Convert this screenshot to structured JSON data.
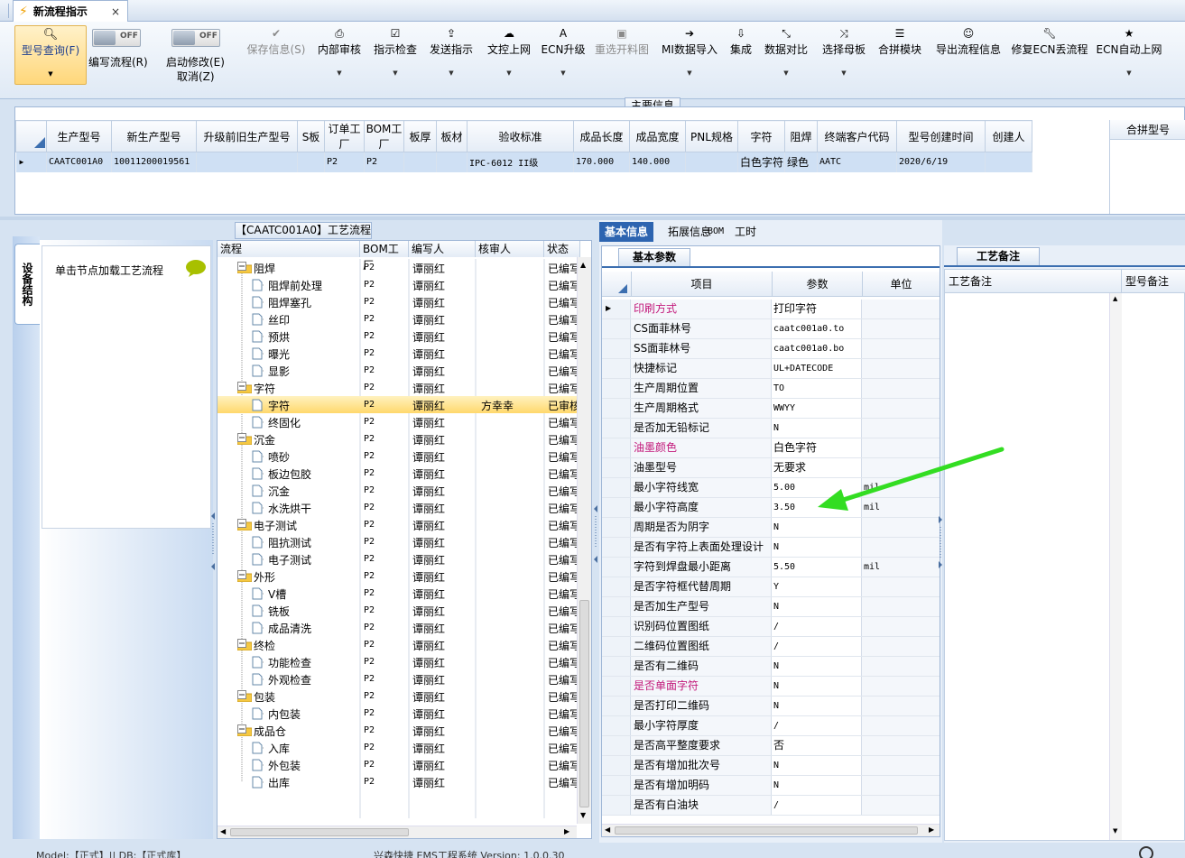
{
  "tab": {
    "title": "新流程指示",
    "close": "×"
  },
  "ribbon": {
    "query": "型号查询(F)",
    "edit_flow": "编写流程(R)",
    "start_modify": "启动修改(E)",
    "cancel": "取消(Z)",
    "toggle_off": "OFF",
    "buttons": [
      {
        "label": "保存信息(S)",
        "icon": "check-icon",
        "disabled": true
      },
      {
        "label": "内部审核",
        "icon": "printer-icon"
      },
      {
        "label": "指示检查",
        "icon": "checkbox-icon"
      },
      {
        "label": "发送指示",
        "icon": "upload-icon"
      },
      {
        "label": "文控上网",
        "icon": "cloud-upload-icon"
      },
      {
        "label": "ECN升级",
        "icon": "font-icon"
      },
      {
        "label": "重选开料图",
        "icon": "image-icon",
        "disabled": true
      },
      {
        "label": "MI数据导入",
        "icon": "sign-in-icon"
      },
      {
        "label": "集成",
        "icon": "download-icon"
      },
      {
        "label": "数据对比",
        "icon": "compress-icon"
      },
      {
        "label": "选择母板",
        "icon": "random-icon"
      },
      {
        "label": "合拼模块",
        "icon": "list-icon"
      },
      {
        "label": "导出流程信息",
        "icon": "smile-icon"
      },
      {
        "label": "修复ECN丢流程",
        "icon": "wrench-icon"
      },
      {
        "label": "ECN自动上网",
        "icon": "star-icon"
      }
    ]
  },
  "main_info": {
    "title": "主要信息",
    "columns": [
      "生产型号",
      "新生产型号",
      "升级前旧生产型号",
      "S板",
      "订单工厂",
      "BOM工厂",
      "板厚",
      "板材",
      "验收标准",
      "成品长度",
      "成品宽度",
      "PNL规格",
      "字符",
      "阻焊",
      "终端客户代码",
      "型号创建时间",
      "创建人"
    ],
    "row": [
      "CAATC001A0",
      "10011200019561",
      "",
      "",
      "P2",
      "P2",
      "",
      "",
      "IPC-6012 II级",
      "170.000",
      "140.000",
      "",
      "白色字符",
      "绿色",
      "AATC",
      "2020/6/19",
      ""
    ],
    "side_title": "合拼型号"
  },
  "process": {
    "title": "【CAATC001A0】工艺流程",
    "side_tab": "设备结构",
    "hint": "单击节点加载工艺流程",
    "columns": [
      "流程",
      "BOM工厂",
      "编写人",
      "核审人",
      "状态"
    ],
    "rows": [
      {
        "name": "阻焊",
        "level": 0,
        "bom": "P2",
        "writer": "谭丽红",
        "reviewer": "",
        "status": "已编写"
      },
      {
        "name": "阻焊前处理",
        "level": 1,
        "bom": "P2",
        "writer": "谭丽红",
        "reviewer": "",
        "status": "已编写"
      },
      {
        "name": "阻焊塞孔",
        "level": 1,
        "bom": "P2",
        "writer": "谭丽红",
        "reviewer": "",
        "status": "已编写"
      },
      {
        "name": "丝印",
        "level": 1,
        "bom": "P2",
        "writer": "谭丽红",
        "reviewer": "",
        "status": "已编写"
      },
      {
        "name": "预烘",
        "level": 1,
        "bom": "P2",
        "writer": "谭丽红",
        "reviewer": "",
        "status": "已编写"
      },
      {
        "name": "曝光",
        "level": 1,
        "bom": "P2",
        "writer": "谭丽红",
        "reviewer": "",
        "status": "已编写"
      },
      {
        "name": "显影",
        "level": 1,
        "bom": "P2",
        "writer": "谭丽红",
        "reviewer": "",
        "status": "已编写"
      },
      {
        "name": "字符",
        "level": 0,
        "bom": "P2",
        "writer": "谭丽红",
        "reviewer": "",
        "status": "已编写"
      },
      {
        "name": "字符",
        "level": 1,
        "bom": "P2",
        "writer": "谭丽红",
        "reviewer": "方幸幸",
        "status": "已审核",
        "selected": true
      },
      {
        "name": "终固化",
        "level": 1,
        "bom": "P2",
        "writer": "谭丽红",
        "reviewer": "",
        "status": "已编写"
      },
      {
        "name": "沉金",
        "level": 0,
        "bom": "P2",
        "writer": "谭丽红",
        "reviewer": "",
        "status": "已编写"
      },
      {
        "name": "喷砂",
        "level": 1,
        "bom": "P2",
        "writer": "谭丽红",
        "reviewer": "",
        "status": "已编写"
      },
      {
        "name": "板边包胶",
        "level": 1,
        "bom": "P2",
        "writer": "谭丽红",
        "reviewer": "",
        "status": "已编写"
      },
      {
        "name": "沉金",
        "level": 1,
        "bom": "P2",
        "writer": "谭丽红",
        "reviewer": "",
        "status": "已编写"
      },
      {
        "name": "水洗烘干",
        "level": 1,
        "bom": "P2",
        "writer": "谭丽红",
        "reviewer": "",
        "status": "已编写"
      },
      {
        "name": "电子测试",
        "level": 0,
        "bom": "P2",
        "writer": "谭丽红",
        "reviewer": "",
        "status": "已编写"
      },
      {
        "name": "阻抗测试",
        "level": 1,
        "bom": "P2",
        "writer": "谭丽红",
        "reviewer": "",
        "status": "已编写"
      },
      {
        "name": "电子测试",
        "level": 1,
        "bom": "P2",
        "writer": "谭丽红",
        "reviewer": "",
        "status": "已编写"
      },
      {
        "name": "外形",
        "level": 0,
        "bom": "P2",
        "writer": "谭丽红",
        "reviewer": "",
        "status": "已编写"
      },
      {
        "name": "V槽",
        "level": 1,
        "bom": "P2",
        "writer": "谭丽红",
        "reviewer": "",
        "status": "已编写"
      },
      {
        "name": "铣板",
        "level": 1,
        "bom": "P2",
        "writer": "谭丽红",
        "reviewer": "",
        "status": "已编写"
      },
      {
        "name": "成品清洗",
        "level": 1,
        "bom": "P2",
        "writer": "谭丽红",
        "reviewer": "",
        "status": "已编写"
      },
      {
        "name": "终检",
        "level": 0,
        "bom": "P2",
        "writer": "谭丽红",
        "reviewer": "",
        "status": "已编写"
      },
      {
        "name": "功能检查",
        "level": 1,
        "bom": "P2",
        "writer": "谭丽红",
        "reviewer": "",
        "status": "已编写"
      },
      {
        "name": "外观检查",
        "level": 1,
        "bom": "P2",
        "writer": "谭丽红",
        "reviewer": "",
        "status": "已编写"
      },
      {
        "name": "包装",
        "level": 0,
        "bom": "P2",
        "writer": "谭丽红",
        "reviewer": "",
        "status": "已编写"
      },
      {
        "name": "内包装",
        "level": 1,
        "bom": "P2",
        "writer": "谭丽红",
        "reviewer": "",
        "status": "已编写"
      },
      {
        "name": "成品仓",
        "level": 0,
        "bom": "P2",
        "writer": "谭丽红",
        "reviewer": "",
        "status": "已编写"
      },
      {
        "name": "入库",
        "level": 1,
        "bom": "P2",
        "writer": "谭丽红",
        "reviewer": "",
        "status": "已编写"
      },
      {
        "name": "外包装",
        "level": 1,
        "bom": "P2",
        "writer": "谭丽红",
        "reviewer": "",
        "status": "已编写"
      },
      {
        "name": "出库",
        "level": 1,
        "bom": "P2",
        "writer": "谭丽红",
        "reviewer": "",
        "status": "已编写"
      }
    ]
  },
  "detail": {
    "tabs": [
      "基本信息",
      "拓展信息",
      "BOM",
      "工时"
    ],
    "subtab": "基本参数",
    "columns": [
      "项目",
      "参数",
      "单位"
    ],
    "rows": [
      {
        "item": "印刷方式",
        "value": "打印字符",
        "unit": "",
        "pink": true
      },
      {
        "item": "CS面菲林号",
        "value": "caatc001a0.to",
        "unit": ""
      },
      {
        "item": "SS面菲林号",
        "value": "caatc001a0.bo",
        "unit": ""
      },
      {
        "item": "快捷标记",
        "value": "UL+DATECODE",
        "unit": ""
      },
      {
        "item": "生产周期位置",
        "value": "TO",
        "unit": ""
      },
      {
        "item": "生产周期格式",
        "value": "WWYY",
        "unit": ""
      },
      {
        "item": "是否加无铅标记",
        "value": "N",
        "unit": ""
      },
      {
        "item": "油墨颜色",
        "value": "白色字符",
        "unit": "",
        "pink": true
      },
      {
        "item": "油墨型号",
        "value": "无要求",
        "unit": ""
      },
      {
        "item": "最小字符线宽",
        "value": "5.00",
        "unit": "mil"
      },
      {
        "item": "最小字符高度",
        "value": "3.50",
        "unit": "mil"
      },
      {
        "item": "周期是否为阴字",
        "value": "N",
        "unit": ""
      },
      {
        "item": "是否有字符上表面处理设计",
        "value": "N",
        "unit": ""
      },
      {
        "item": "字符到焊盘最小距离",
        "value": "5.50",
        "unit": "mil"
      },
      {
        "item": "是否字符框代替周期",
        "value": "Y",
        "unit": ""
      },
      {
        "item": "是否加生产型号",
        "value": "N",
        "unit": ""
      },
      {
        "item": "识别码位置图纸",
        "value": "/",
        "unit": ""
      },
      {
        "item": "二维码位置图纸",
        "value": "/",
        "unit": ""
      },
      {
        "item": "是否有二维码",
        "value": "N",
        "unit": ""
      },
      {
        "item": "是否单面字符",
        "value": "N",
        "unit": "",
        "pink": true
      },
      {
        "item": "是否打印二维码",
        "value": "N",
        "unit": ""
      },
      {
        "item": "最小字符厚度",
        "value": "/",
        "unit": ""
      },
      {
        "item": "是否高平整度要求",
        "value": "否",
        "unit": ""
      },
      {
        "item": "是否有增加批次号",
        "value": "N",
        "unit": ""
      },
      {
        "item": "是否有增加明码",
        "value": "N",
        "unit": ""
      },
      {
        "item": "是否有白油块",
        "value": "/",
        "unit": ""
      }
    ]
  },
  "notes": {
    "tab": "工艺备注",
    "col1": "工艺备注",
    "col2": "型号备注"
  },
  "colors": {
    "accent_green": "#33dd22",
    "pink": "#c2187a",
    "highlight": "#ffd86c"
  },
  "status": {
    "left": "Model:【正式】|| DB:【正式库】",
    "center": "兴森快捷 EMS工程系统 Version: 1.0.0.30"
  }
}
